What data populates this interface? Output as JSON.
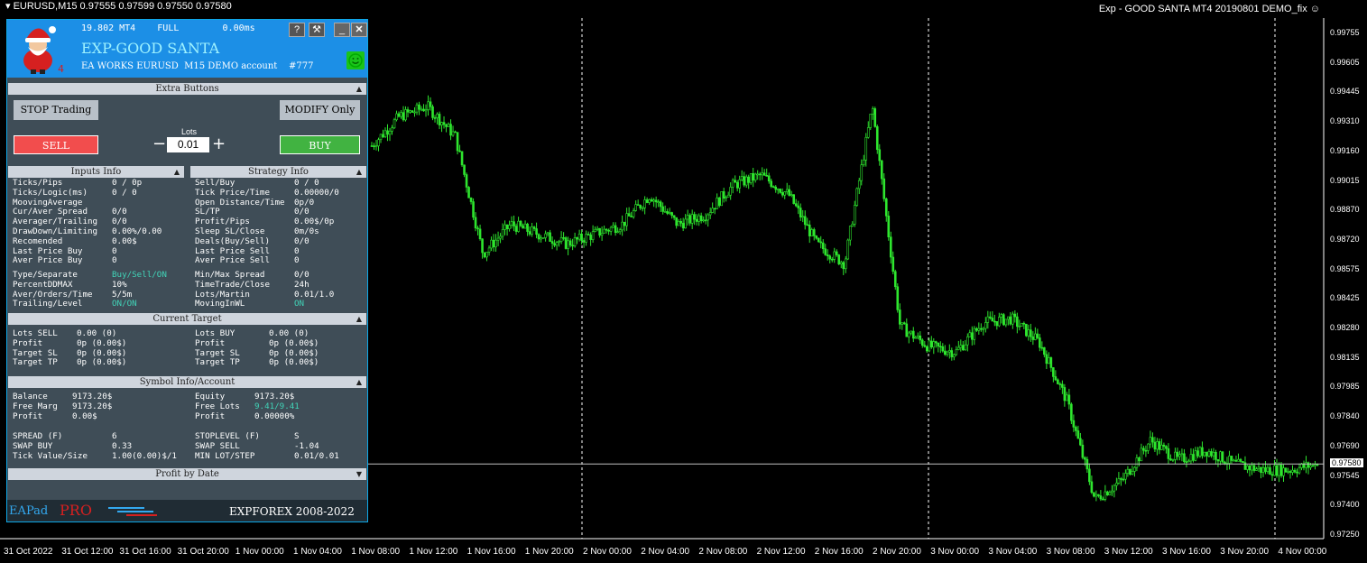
{
  "window": {
    "symbol_line": "EURUSD,M15  0.97555 0.97599 0.97550 0.97580",
    "ea_title": "Exp - GOOD SANTA MT4 20190801 DEMO_fix"
  },
  "panel": {
    "header": {
      "line1": "19.802 MT4    FULL        0.00ms",
      "name": "EXP-GOOD SANTA",
      "line3": "EA WORKS EURUSD  M15 DEMO account    #777",
      "help_label": "?",
      "tools_label": "⚒",
      "min_label": "_",
      "close_label": "✕"
    },
    "extra_buttons": {
      "title": "Extra Buttons",
      "stop_label": "STOP Trading",
      "modify_label": "MODIFY Only"
    },
    "trade": {
      "sell_label": "SELL",
      "buy_label": "BUY",
      "lots_caption": "Lots",
      "lots_value": "0.01",
      "minus": "−",
      "plus": "+"
    },
    "inputs_info": {
      "title": "Inputs Info",
      "rows": [
        [
          "Ticks/Pips",
          "0 / 0p"
        ],
        [
          "Ticks/Logic(ms)",
          "0 / 0"
        ],
        [
          "MoovingAverage",
          ""
        ],
        [
          "Cur/Aver Spread",
          "0/0"
        ],
        [
          "Averager/Trailing",
          "0/0"
        ],
        [
          "DrawDown/Limiting",
          "0.00%/0.00"
        ],
        [
          "Recomended",
          "0.00$"
        ],
        [
          "Last Price Buy",
          "0"
        ],
        [
          "Aver Price Buy",
          "0"
        ]
      ],
      "rows2": [
        [
          "Type/Separate",
          "Buy/Sell/ON"
        ],
        [
          "PercentDDMAX",
          "10%"
        ],
        [
          "Aver/Orders/Time",
          "5/5m"
        ],
        [
          "Trailing/Level",
          "ON/ON"
        ]
      ]
    },
    "strategy_info": {
      "title": "Strategy Info",
      "rows": [
        [
          "Sell/Buy",
          "0 / 0"
        ],
        [
          "Tick Price/Time",
          "0.00000/0"
        ],
        [
          "Open Distance/Time",
          "0p/0"
        ],
        [
          "SL/TP",
          "0/0"
        ],
        [
          "Profit/Pips",
          "0.00$/0p"
        ],
        [
          "Sleep SL/Close",
          "0m/0s"
        ],
        [
          "Deals(Buy/Sell)",
          "0/0"
        ],
        [
          "Last Price Sell",
          "0"
        ],
        [
          "Aver Price Sell",
          "0"
        ]
      ],
      "rows2": [
        [
          "Min/Max Spread",
          "0/0"
        ],
        [
          "TimeTrade/Close",
          "24h"
        ],
        [
          "Lots/Martin",
          "0.01/1.0"
        ],
        [
          "MovingInWL",
          "ON"
        ]
      ]
    },
    "current_target": {
      "title": "Current Target",
      "left": [
        [
          "Lots SELL",
          "0.00 (0)"
        ],
        [
          "Profit",
          "0p (0.00$)"
        ],
        [
          "Target SL",
          "0p (0.00$)"
        ],
        [
          "Target TP",
          "0p (0.00$)"
        ]
      ],
      "right": [
        [
          "Lots BUY",
          "0.00 (0)"
        ],
        [
          "Profit",
          "0p (0.00$)"
        ],
        [
          "Target SL",
          "0p (0.00$)"
        ],
        [
          "Target TP",
          "0p (0.00$)"
        ]
      ]
    },
    "symbol_info": {
      "title": "Symbol Info/Account",
      "left": [
        [
          "Balance",
          "9173.20$"
        ],
        [
          "Free Marg",
          "9173.20$"
        ],
        [
          "Profit",
          "0.00$"
        ]
      ],
      "right": [
        [
          "Equity",
          "9173.20$"
        ],
        [
          "Free Lots",
          "9.41/9.41"
        ],
        [
          "Profit",
          "0.00000%"
        ]
      ],
      "left2": [
        [
          "SPREAD (F)",
          "6"
        ],
        [
          "SWAP BUY",
          "0.33"
        ],
        [
          "Tick Value/Size",
          "1.00(0.00)$/1"
        ]
      ],
      "right2": [
        [
          "STOPLEVEL (F)",
          "S"
        ],
        [
          "SWAP SELL",
          "-1.04"
        ],
        [
          "MIN LOT/STEP",
          "0.01/0.01"
        ]
      ]
    },
    "profit_by_date": {
      "title": "Profit by Date"
    },
    "footer": {
      "ea": "EA",
      "pad": "Pad",
      "pro": "PRO",
      "copyright": "EXPFOREX 2008-2022"
    },
    "colors": {
      "sell": "#f24d4d",
      "buy": "#41b341",
      "header": "#1c8fe6",
      "cyan": "#41d4b8"
    }
  },
  "price_axis": {
    "labels": [
      "0.99755",
      "0.99605",
      "0.99445",
      "0.99310",
      "0.99160",
      "0.99015",
      "0.98870",
      "0.98720",
      "0.98575",
      "0.98425",
      "0.98280",
      "0.98135",
      "0.97985",
      "0.97840",
      "0.97690",
      "0.97545",
      "0.97400",
      "0.97250"
    ],
    "current_price": "0.97580"
  },
  "time_axis": {
    "labels": [
      "31 Oct 2022",
      "31 Oct 12:00",
      "31 Oct 16:00",
      "31 Oct 20:00",
      "1 Nov 00:00",
      "1 Nov 04:00",
      "1 Nov 08:00",
      "1 Nov 12:00",
      "1 Nov 16:00",
      "1 Nov 20:00",
      "2 Nov 00:00",
      "2 Nov 04:00",
      "2 Nov 08:00",
      "2 Nov 12:00",
      "2 Nov 16:00",
      "2 Nov 20:00",
      "3 Nov 00:00",
      "3 Nov 04:00",
      "3 Nov 08:00",
      "3 Nov 12:00",
      "3 Nov 16:00",
      "3 Nov 20:00",
      "4 Nov 00:00"
    ]
  },
  "chart_data": {
    "type": "candlestick",
    "symbol": "EURUSD",
    "timeframe": "M15",
    "x": [
      "1 Nov 08:00",
      "1 Nov 10:00",
      "1 Nov 12:00",
      "1 Nov 14:00",
      "1 Nov 16:00",
      "1 Nov 18:00",
      "1 Nov 20:00",
      "1 Nov 22:00",
      "2 Nov 00:00",
      "2 Nov 02:00",
      "2 Nov 04:00",
      "2 Nov 06:00",
      "2 Nov 08:00",
      "2 Nov 10:00",
      "2 Nov 12:00",
      "2 Nov 14:00",
      "2 Nov 16:00",
      "2 Nov 18:00",
      "2 Nov 19:00",
      "2 Nov 20:00",
      "2 Nov 22:00",
      "3 Nov 00:00",
      "3 Nov 02:00",
      "3 Nov 04:00",
      "3 Nov 06:00",
      "3 Nov 08:00",
      "3 Nov 10:00",
      "3 Nov 12:00",
      "3 Nov 14:00",
      "3 Nov 16:00",
      "3 Nov 18:00",
      "3 Nov 20:00",
      "3 Nov 22:00",
      "4 Nov 00:00",
      "4 Nov 01:00"
    ],
    "close": [
      0.992,
      0.9935,
      0.994,
      0.9925,
      0.9865,
      0.988,
      0.9875,
      0.987,
      0.9875,
      0.988,
      0.9895,
      0.988,
      0.9885,
      0.99,
      0.9905,
      0.9895,
      0.987,
      0.986,
      0.994,
      0.9828,
      0.9818,
      0.9815,
      0.983,
      0.9832,
      0.982,
      0.979,
      0.974,
      0.975,
      0.977,
      0.976,
      0.9765,
      0.9758,
      0.9755,
      0.9755,
      0.9758
    ],
    "ylim": [
      0.972,
      0.9985
    ],
    "current_price": 0.9758
  }
}
